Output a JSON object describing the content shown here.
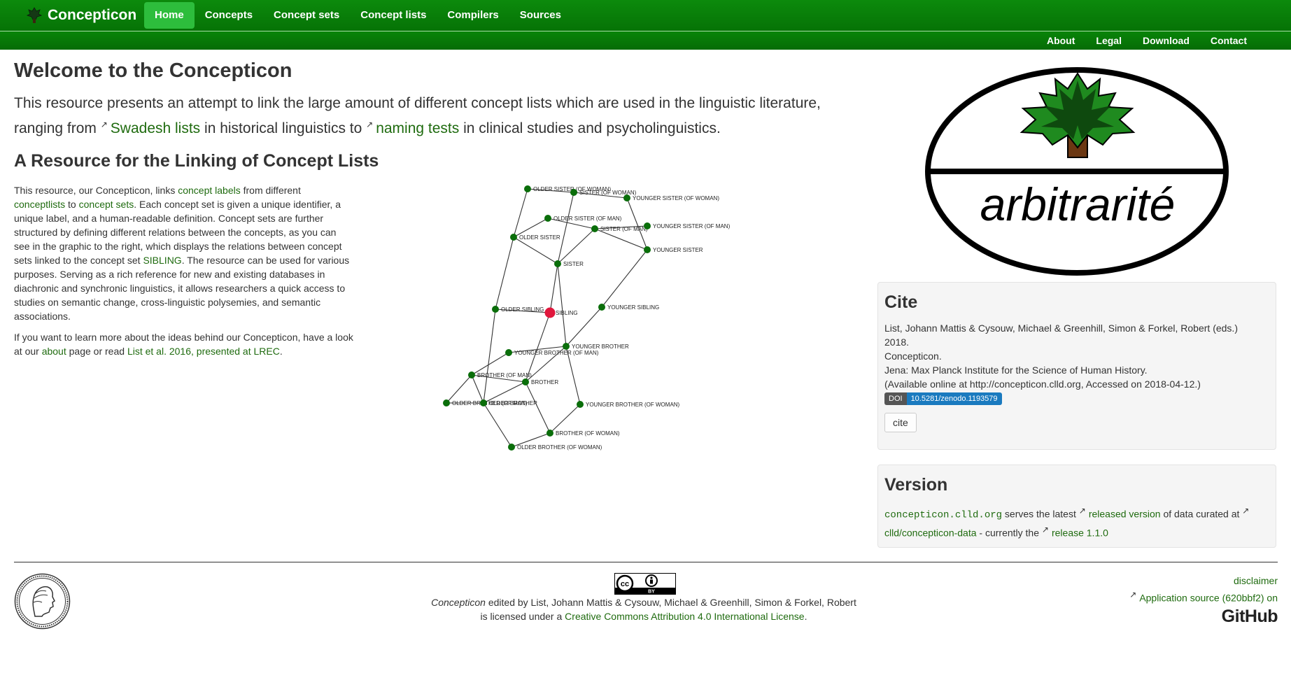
{
  "navbar": {
    "brand": "Concepticon",
    "items": [
      {
        "label": "Home",
        "active": true
      },
      {
        "label": "Concepts"
      },
      {
        "label": "Concept sets"
      },
      {
        "label": "Concept lists"
      },
      {
        "label": "Compilers"
      },
      {
        "label": "Sources"
      }
    ],
    "subitems": [
      "About",
      "Legal",
      "Download",
      "Contact"
    ],
    "accent": "#0c8a0c"
  },
  "main": {
    "title": "Welcome to the Concepticon",
    "intro": {
      "t1": "This resource presents an attempt to link the large amount of different concept lists which are used in the linguistic literature, ranging from",
      "link1": "Swadesh lists",
      "t2": "in historical linguistics to",
      "link2": "naming tests",
      "t3": "in clinical studies and psycholinguistics."
    },
    "section_title": "A Resource for the Linking of Concept Lists",
    "para1": {
      "t1": "This resource, our Concepticon, links",
      "link1": "concept labels",
      "t2": "from different",
      "link2": "conceptlists",
      "t3": "to",
      "link3": "concept sets",
      "t4": ". Each concept set is given a unique identifier, a unique label, and a human-readable definition. Concept sets are further structured by defining different relations between the concepts, as you can see in the graphic to the right, which displays the relations between concept sets linked to the concept set",
      "link4": "SIBLING",
      "t5": ". The resource can be used for various purposes. Serving as a rich reference for new and existing databases in diachronic and synchronic linguistics, it allows researchers a quick access to studies on semantic change, cross-linguistic polysemies, and semantic associations."
    },
    "para2": {
      "t1": "If you want to learn more about the ideas behind our Concepticon, have a look at our",
      "link1": "about",
      "t2": "page or read",
      "link2": "List et al. 2016, presented at LREC",
      "t3": "."
    }
  },
  "graph": {
    "nodes": [
      {
        "id": "osw",
        "label": "OLDER SISTER (OF WOMAN)"
      },
      {
        "id": "sw",
        "label": "SISTER (OF WOMAN)"
      },
      {
        "id": "ysw",
        "label": "YOUNGER SISTER (OF WOMAN)"
      },
      {
        "id": "osm",
        "label": "OLDER SISTER (OF MAN)"
      },
      {
        "id": "os",
        "label": "OLDER SISTER"
      },
      {
        "id": "sm",
        "label": "SISTER (OF MAN)"
      },
      {
        "id": "ysm",
        "label": "YOUNGER SISTER (OF MAN)"
      },
      {
        "id": "ys",
        "label": "YOUNGER SISTER"
      },
      {
        "id": "sis",
        "label": "SISTER"
      },
      {
        "id": "osib",
        "label": "OLDER SIBLING"
      },
      {
        "id": "sib",
        "label": "SIBLING",
        "center": true
      },
      {
        "id": "ysib",
        "label": "YOUNGER SIBLING"
      },
      {
        "id": "yb",
        "label": "YOUNGER BROTHER"
      },
      {
        "id": "ybm",
        "label": "YOUNGER BROTHER (OF MAN)"
      },
      {
        "id": "bm",
        "label": "BROTHER (OF MAN)"
      },
      {
        "id": "br",
        "label": "BROTHER"
      },
      {
        "id": "obm",
        "label": "OLDER BROTHER (OF MAN)"
      },
      {
        "id": "ob",
        "label": "OLDER BROTHER"
      },
      {
        "id": "ybw",
        "label": "YOUNGER BROTHER (OF WOMAN)"
      },
      {
        "id": "bw",
        "label": "BROTHER (OF WOMAN)"
      },
      {
        "id": "obw",
        "label": "OLDER BROTHER (OF WOMAN)"
      }
    ],
    "edges": [
      [
        "osw",
        "sw"
      ],
      [
        "sw",
        "ysw"
      ],
      [
        "osw",
        "os"
      ],
      [
        "sw",
        "sis"
      ],
      [
        "ysw",
        "ys"
      ],
      [
        "osm",
        "sm"
      ],
      [
        "sm",
        "ysm"
      ],
      [
        "os",
        "osm"
      ],
      [
        "sm",
        "sis"
      ],
      [
        "sm",
        "ys"
      ],
      [
        "os",
        "sis"
      ],
      [
        "ys",
        "ysib"
      ],
      [
        "sis",
        "sib"
      ],
      [
        "sis",
        "yb"
      ],
      [
        "os",
        "osib"
      ],
      [
        "osib",
        "sib"
      ],
      [
        "ysib",
        "yb"
      ],
      [
        "sib",
        "br"
      ],
      [
        "osib",
        "ob"
      ],
      [
        "ybm",
        "yb"
      ],
      [
        "bm",
        "ybm"
      ],
      [
        "bm",
        "br"
      ],
      [
        "bm",
        "obm"
      ],
      [
        "bm",
        "ob"
      ],
      [
        "yb",
        "br"
      ],
      [
        "yb",
        "ybw"
      ],
      [
        "br",
        "ob"
      ],
      [
        "obm",
        "ob"
      ],
      [
        "ob",
        "obw"
      ],
      [
        "br",
        "bw"
      ],
      [
        "ybw",
        "bw"
      ],
      [
        "bw",
        "obw"
      ]
    ],
    "node_color": "#0a6e0a",
    "center_color": "#e0173c"
  },
  "logo": {
    "text": "arbitrarité"
  },
  "cite": {
    "title": "Cite",
    "lines": [
      "List, Johann Mattis & Cysouw, Michael & Greenhill, Simon & Forkel, Robert (eds.)",
      "2018.",
      "Concepticon.",
      "Jena: Max Planck Institute for the Science of Human History.",
      "(Available online at http://concepticon.clld.org, Accessed on 2018-04-12.)"
    ],
    "doi_label": "DOI",
    "doi_value": "10.5281/zenodo.1193579",
    "button": "cite"
  },
  "version": {
    "title": "Version",
    "site": "concepticon.clld.org",
    "t1": "serves the latest",
    "link1": "released version",
    "t2": "of data curated at",
    "link2": "clld/concepticon-data",
    "t3": "- currently the",
    "link3": "release 1.1.0"
  },
  "footer": {
    "cc_label": "BY",
    "license_title": "Concepticon",
    "license_t1": "edited by List, Johann Mattis & Cysouw, Michael & Greenhill, Simon & Forkel, Robert",
    "license_t2": "is licensed under a",
    "license_link": "Creative Commons Attribution 4.0 International License",
    "license_t3": ".",
    "disclaimer": "disclaimer",
    "source": "Application source (620bbf2) on",
    "github": "GitHub"
  }
}
